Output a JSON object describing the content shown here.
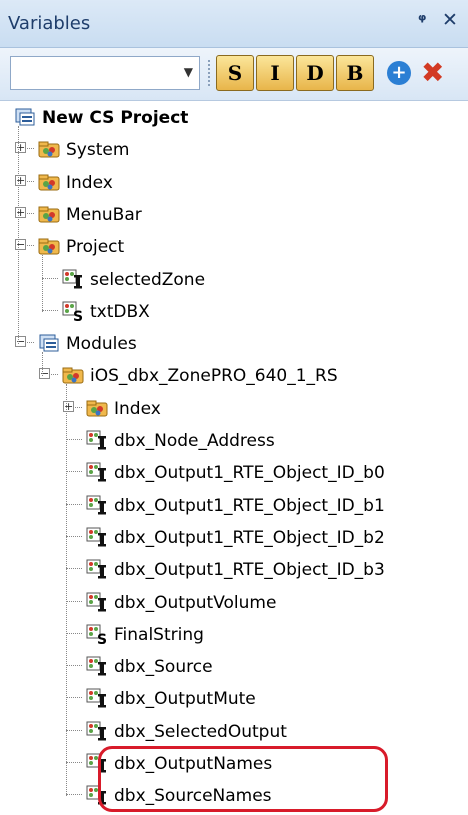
{
  "panel": {
    "title": "Variables",
    "pin": "ᵠ",
    "close": "✕"
  },
  "toolbar": {
    "combo_value": "",
    "buttons": [
      "S",
      "I",
      "D",
      "B"
    ],
    "add_label": "+",
    "remove_label": "✖"
  },
  "tree": [
    {
      "label": "New CS Project",
      "bold": true,
      "icon": "project-icon"
    },
    {
      "label": "System",
      "icon": "module-icon"
    },
    {
      "label": "Index",
      "icon": "module-icon"
    },
    {
      "label": "MenuBar",
      "icon": "module-icon"
    },
    {
      "label": "Project",
      "icon": "module-icon"
    },
    {
      "label": "selectedZone",
      "icon": "int-var-icon"
    },
    {
      "label": "txtDBX",
      "icon": "string-var-icon"
    },
    {
      "label": "Modules",
      "icon": "project-icon"
    },
    {
      "label": "iOS_dbx_ZonePRO_640_1_RS",
      "icon": "module-icon"
    },
    {
      "label": "Index",
      "icon": "module-icon"
    },
    {
      "label": "dbx_Node_Address",
      "icon": "int-var-icon"
    },
    {
      "label": "dbx_Output1_RTE_Object_ID_b0",
      "icon": "int-var-icon"
    },
    {
      "label": "dbx_Output1_RTE_Object_ID_b1",
      "icon": "int-var-icon"
    },
    {
      "label": "dbx_Output1_RTE_Object_ID_b2",
      "icon": "int-var-icon"
    },
    {
      "label": "dbx_Output1_RTE_Object_ID_b3",
      "icon": "int-var-icon"
    },
    {
      "label": "dbx_OutputVolume",
      "icon": "int-var-icon"
    },
    {
      "label": "FinalString",
      "icon": "string-var-icon"
    },
    {
      "label": "dbx_Source",
      "icon": "int-var-icon"
    },
    {
      "label": "dbx_OutputMute",
      "icon": "int-var-icon"
    },
    {
      "label": "dbx_SelectedOutput",
      "icon": "int-var-icon"
    },
    {
      "label": "dbx_OutputNames",
      "icon": "int-var-icon"
    },
    {
      "label": "dbx_SourceNames",
      "icon": "int-var-icon"
    }
  ],
  "colors": {
    "highlight": "#d81b2a",
    "accent": "#2b7fd4"
  }
}
